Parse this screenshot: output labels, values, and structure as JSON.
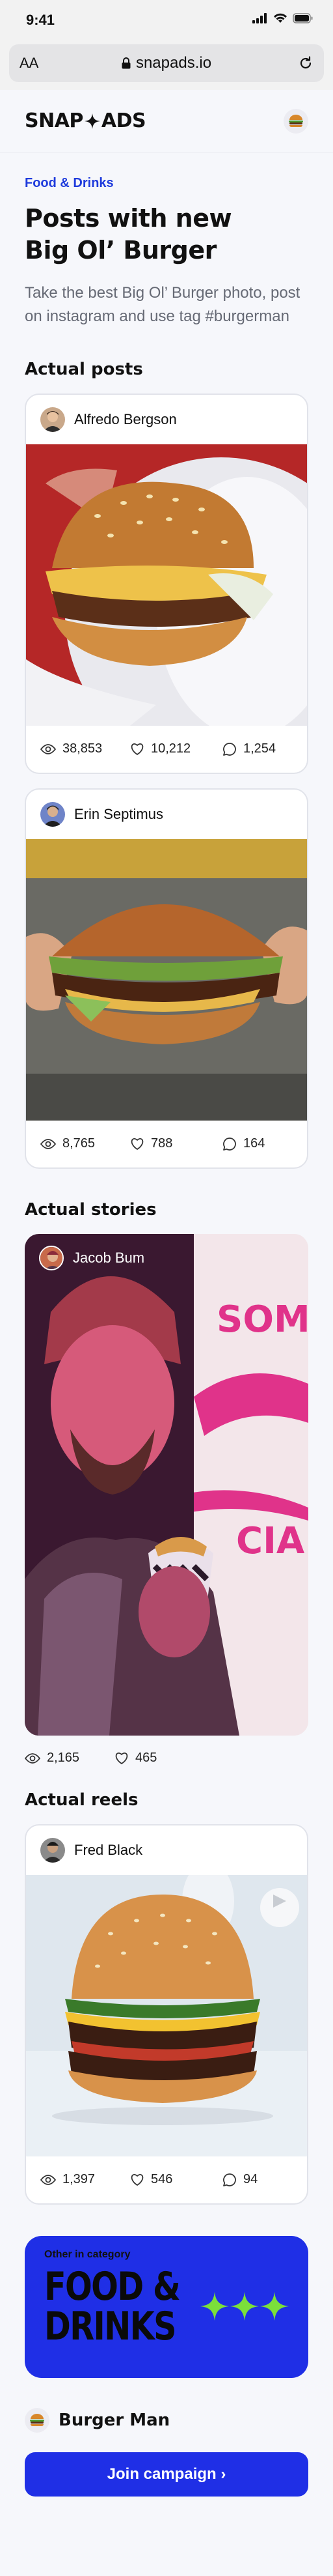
{
  "status_bar": {
    "time": "9:41"
  },
  "browser": {
    "text_size": "AA",
    "url": "snapads.io"
  },
  "header": {
    "logo_left": "SNAP",
    "logo_right": "ADS"
  },
  "page": {
    "category": "Food & Drinks",
    "title_line1": "Posts with new",
    "title_line2": "Big Ol’ Burger",
    "description": "Take the best Big Ol’ Burger photo, post on instagram and use tag #burgerman"
  },
  "sections": {
    "posts": "Actual posts",
    "stories": "Actual stories",
    "reels": "Actual reels"
  },
  "posts": [
    {
      "author": "Alfredo Bergson",
      "views": "38,853",
      "likes": "10,212",
      "comments": "1,254"
    },
    {
      "author": "Erin Septimus",
      "views": "8,765",
      "likes": "788",
      "comments": "164"
    }
  ],
  "story": {
    "author": "Jacob Bum",
    "views": "2,165",
    "likes": "465"
  },
  "reel": {
    "author": "Fred Black",
    "views": "1,397",
    "likes": "546",
    "comments": "94"
  },
  "promo": {
    "label": "Other in category",
    "title_line1": "FOOD &",
    "title_line2": "DRINKS"
  },
  "brand": {
    "name": "Burger Man"
  },
  "cta": {
    "label": "Join campaign ›"
  },
  "colors": {
    "accent": "#1f2fe6",
    "category_text": "#1f3bdc",
    "promo_stars": "#7be03a"
  }
}
